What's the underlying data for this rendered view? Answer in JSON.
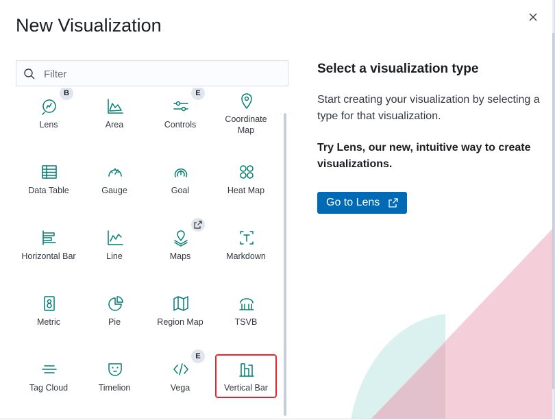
{
  "modal": {
    "title": "New Visualization",
    "close_icon": "close-icon"
  },
  "search": {
    "placeholder": "Filter",
    "value": ""
  },
  "types": [
    {
      "label": "Lens",
      "icon": "lens-icon",
      "badge": "B"
    },
    {
      "label": "Area",
      "icon": "area-chart-icon",
      "badge": ""
    },
    {
      "label": "Controls",
      "icon": "controls-icon",
      "badge": "E"
    },
    {
      "label": "Coordinate Map",
      "icon": "map-pin-icon",
      "badge": ""
    },
    {
      "label": "Data Table",
      "icon": "table-icon",
      "badge": ""
    },
    {
      "label": "Gauge",
      "icon": "gauge-icon",
      "badge": ""
    },
    {
      "label": "Goal",
      "icon": "goal-icon",
      "badge": ""
    },
    {
      "label": "Heat Map",
      "icon": "heatmap-icon",
      "badge": ""
    },
    {
      "label": "Horizontal Bar",
      "icon": "horizontal-bar-icon",
      "badge": ""
    },
    {
      "label": "Line",
      "icon": "line-chart-icon",
      "badge": ""
    },
    {
      "label": "Maps",
      "icon": "maps-icon",
      "badge": "external-link-icon"
    },
    {
      "label": "Markdown",
      "icon": "markdown-icon",
      "badge": ""
    },
    {
      "label": "Metric",
      "icon": "metric-icon",
      "badge": ""
    },
    {
      "label": "Pie",
      "icon": "pie-chart-icon",
      "badge": ""
    },
    {
      "label": "Region Map",
      "icon": "region-map-icon",
      "badge": ""
    },
    {
      "label": "TSVB",
      "icon": "tsvb-icon",
      "badge": ""
    },
    {
      "label": "Tag Cloud",
      "icon": "tag-cloud-icon",
      "badge": ""
    },
    {
      "label": "Timelion",
      "icon": "timelion-icon",
      "badge": ""
    },
    {
      "label": "Vega",
      "icon": "code-icon",
      "badge": "E"
    },
    {
      "label": "Vertical Bar",
      "icon": "vertical-bar-icon",
      "badge": ""
    }
  ],
  "selected": "Vertical Bar",
  "side": {
    "heading": "Select a visualization type",
    "description": "Start creating your visualization by selecting a type for that visualization.",
    "promo": "Try Lens, our new, intuitive way to create visualizations.",
    "lens_button": "Go to Lens"
  },
  "colors": {
    "icon": "#017d73",
    "accent": "#006bb4",
    "highlight": "#e7262c"
  }
}
